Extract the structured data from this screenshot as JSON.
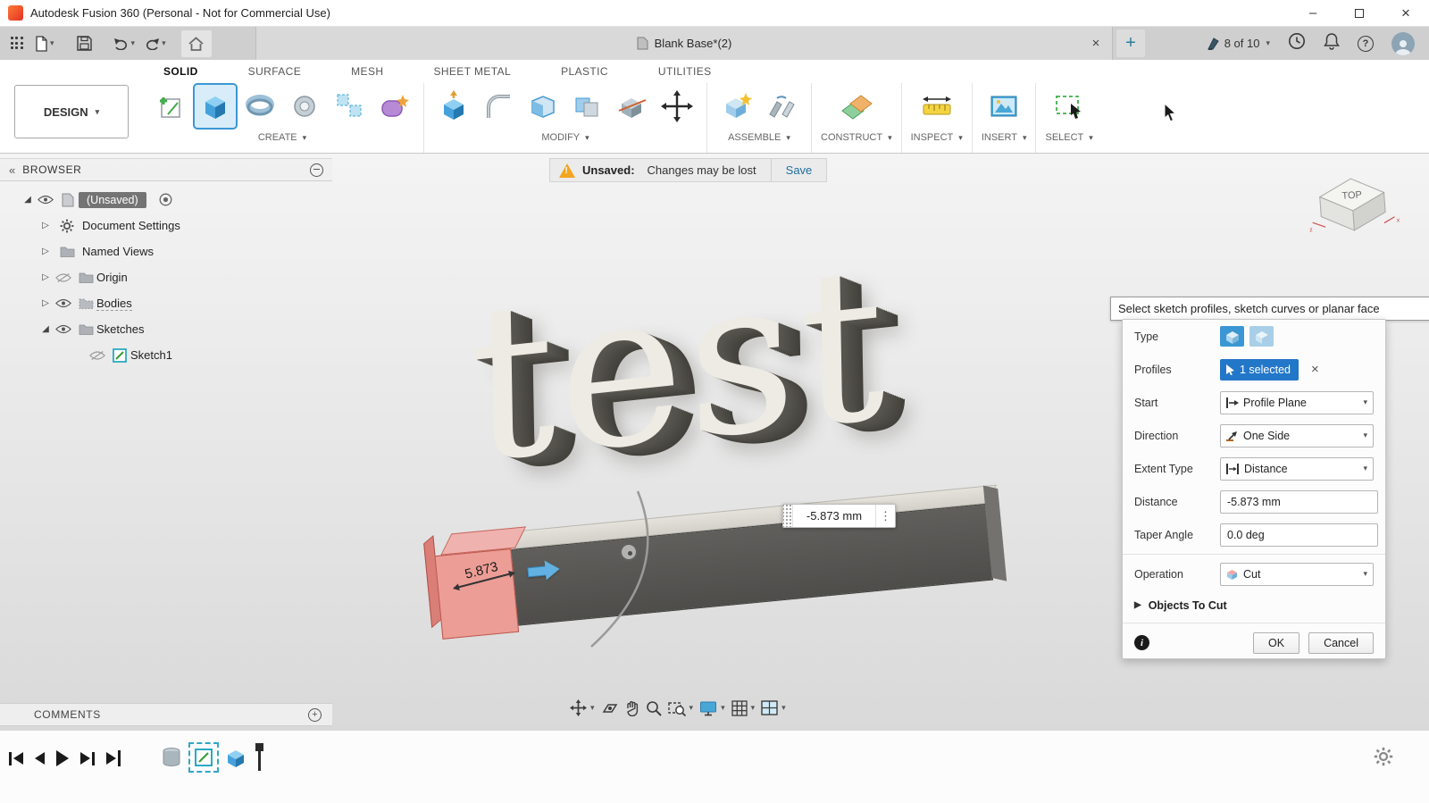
{
  "window": {
    "title": "Autodesk Fusion 360 (Personal - Not for Commercial Use)"
  },
  "appbar": {
    "document_tab": "Blank Base*(2)",
    "tokens_badge": "8 of 10"
  },
  "ribbon": {
    "design_label": "DESIGN",
    "tabs": [
      "SOLID",
      "SURFACE",
      "MESH",
      "SHEET METAL",
      "PLASTIC",
      "UTILITIES"
    ],
    "active_tab": "SOLID",
    "groups": [
      "CREATE",
      "MODIFY",
      "ASSEMBLE",
      "CONSTRUCT",
      "INSPECT",
      "INSERT",
      "SELECT"
    ]
  },
  "warning_bar": {
    "label": "Unsaved:",
    "message": "Changes may be lost",
    "action": "Save"
  },
  "browser": {
    "title": "BROWSER",
    "items": [
      {
        "label": "(Unsaved)"
      },
      {
        "label": "Document Settings"
      },
      {
        "label": "Named Views"
      },
      {
        "label": "Origin"
      },
      {
        "label": "Bodies"
      },
      {
        "label": "Sketches"
      },
      {
        "label": "Sketch1"
      }
    ]
  },
  "viewport": {
    "model_text": "test",
    "dimension_label": "5.873",
    "distance_input": "-5.873 mm",
    "viewcube_face": "TOP"
  },
  "tooltip": {
    "text": "Select sketch profiles, sketch curves or planar face"
  },
  "dialog": {
    "type_label": "Type",
    "profiles_label": "Profiles",
    "profiles_value": "1 selected",
    "start_label": "Start",
    "start_value": "Profile Plane",
    "direction_label": "Direction",
    "direction_value": "One Side",
    "extent_type_label": "Extent Type",
    "extent_type_value": "Distance",
    "distance_label": "Distance",
    "distance_value": "-5.873 mm",
    "taper_angle_label": "Taper Angle",
    "taper_angle_value": "0.0 deg",
    "operation_label": "Operation",
    "operation_value": "Cut",
    "objects_to_cut_label": "Objects To Cut",
    "ok_label": "OK",
    "cancel_label": "Cancel"
  },
  "comments": {
    "title": "COMMENTS"
  },
  "colors": {
    "accent_blue": "#0696d7",
    "selection_blue": "#2377c8",
    "profile_highlight_red": "#ec9d96",
    "warning_yellow": "#f2a51e"
  },
  "icons": {
    "caret_down": "▾",
    "collapse_left": "«",
    "tree_expanded": "◢",
    "tree_collapsed": "▷",
    "close": "×",
    "plus": "+",
    "overflow_dots": "⋮",
    "question": "?",
    "info": "i",
    "exclaim": "!",
    "section_arrow": "▶",
    "minimize": "–"
  }
}
